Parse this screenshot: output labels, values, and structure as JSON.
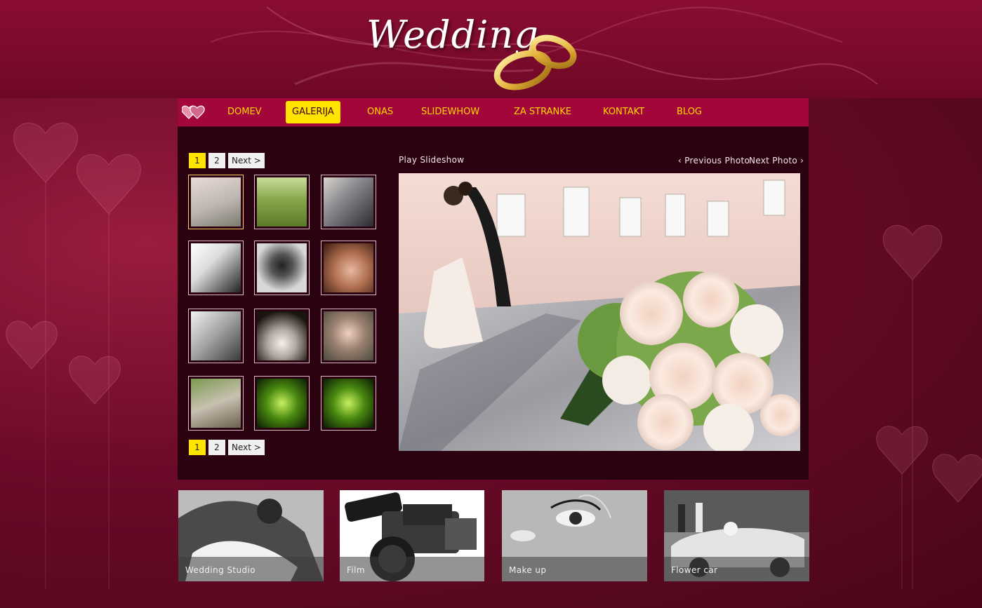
{
  "brand": {
    "logo_text": "Wedding"
  },
  "nav": {
    "items": [
      {
        "label": "DOMEV"
      },
      {
        "label": "GALERIJA"
      },
      {
        "label": "ONAS"
      },
      {
        "label": "SLIDEWHOW"
      },
      {
        "label": "ZA STRANKE"
      },
      {
        "label": "KONTAKT"
      },
      {
        "label": "BLOG"
      }
    ],
    "active_index": 1
  },
  "gallery": {
    "pager_top": {
      "pages": [
        "1",
        "2"
      ],
      "current": "1",
      "next_label": "Next >"
    },
    "pager_bottom": {
      "pages": [
        "1",
        "2"
      ],
      "current": "1",
      "next_label": "Next >"
    },
    "thumbnail_count": 12,
    "selected_thumbnail": 1
  },
  "viewer": {
    "play_label": "Play Slideshow",
    "prev_label": "‹ Previous Photo",
    "next_label": "Next Photo ›"
  },
  "tiles": [
    {
      "caption": "Wedding Studio"
    },
    {
      "caption": "Film"
    },
    {
      "caption": "Make up"
    },
    {
      "caption": "Flower car"
    }
  ],
  "colors": {
    "nav_bg": "#a2063a",
    "nav_text": "#ffd800",
    "active_bg": "#ffe400",
    "panel_bg": "#2b0210"
  }
}
